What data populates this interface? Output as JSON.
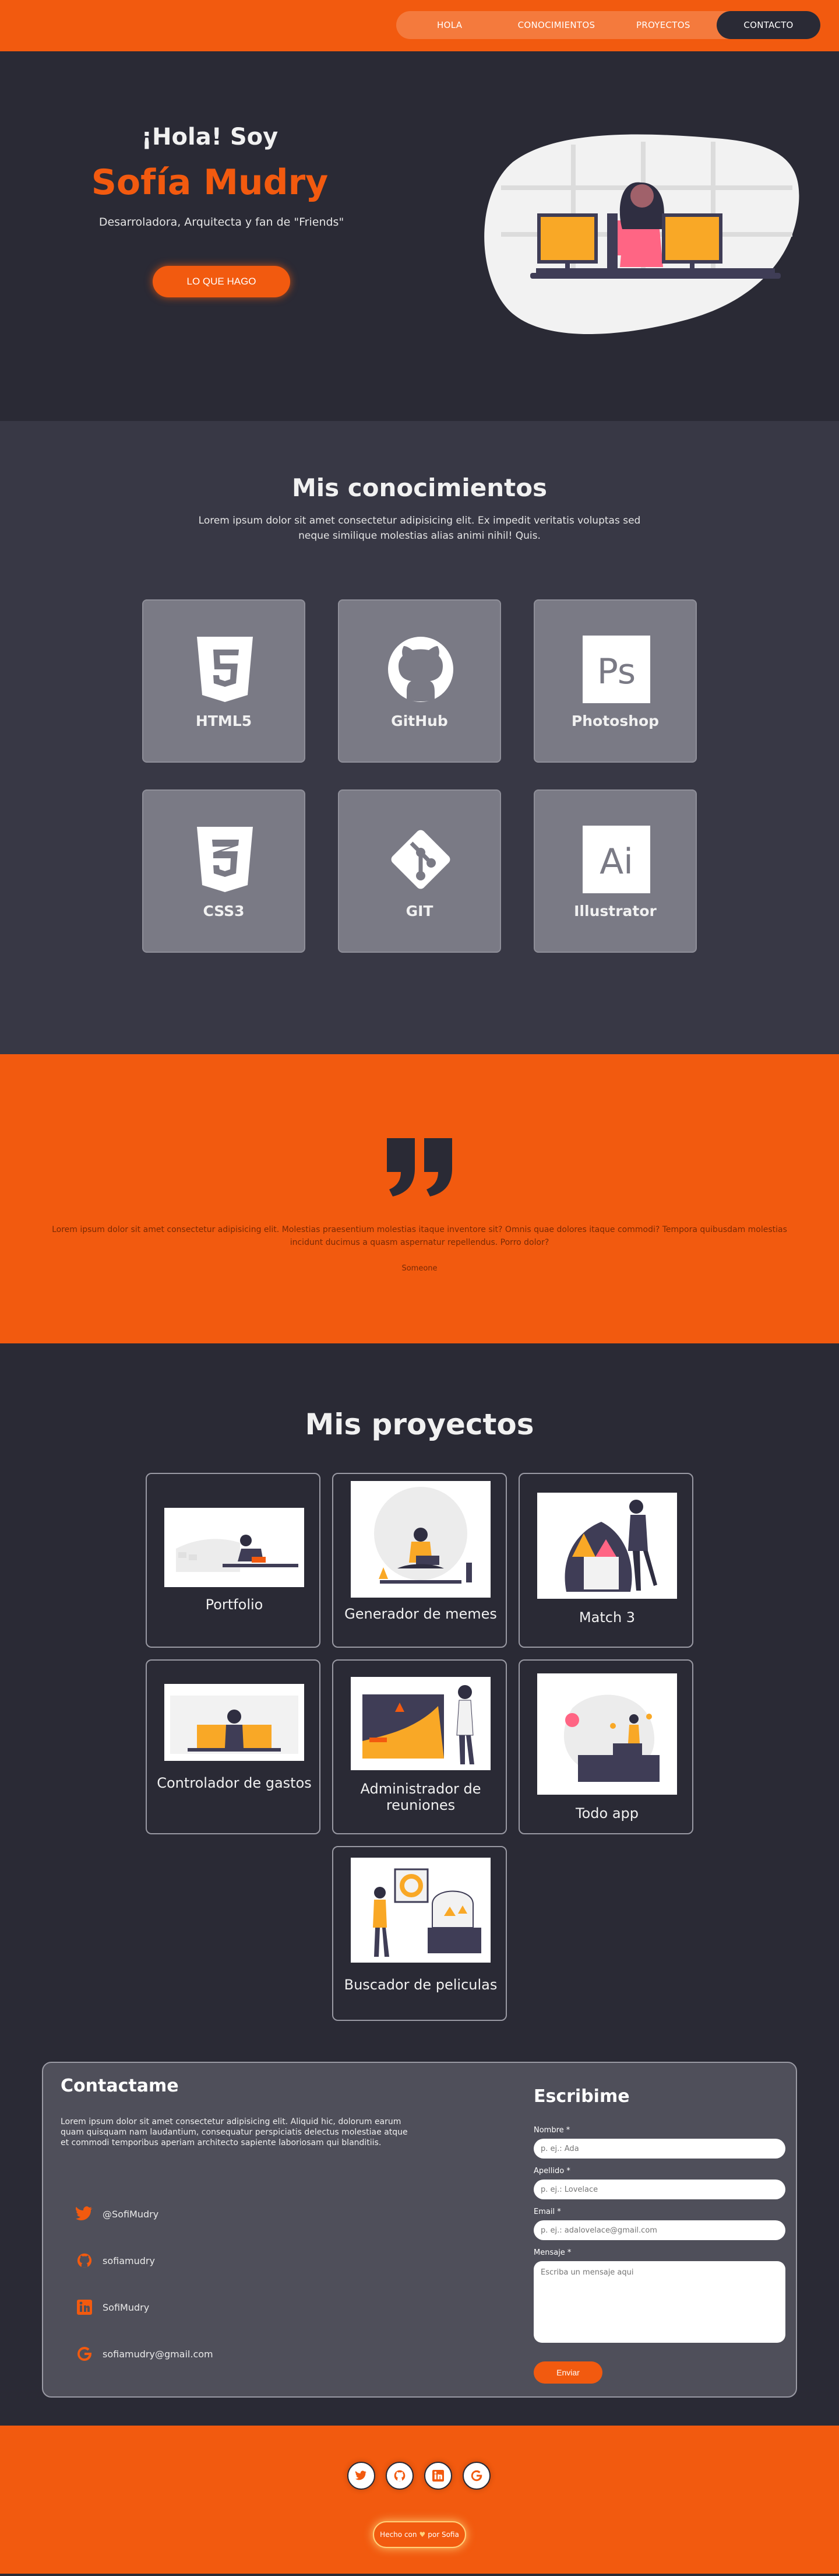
{
  "nav": {
    "items": [
      "HOLA",
      "CONOCIMIENTOS",
      "PROYECTOS",
      "CONTACTO"
    ]
  },
  "hero": {
    "greeting": "¡Hola! Soy",
    "name": "Sofía Mudry",
    "subtitle": "Desarroladora, Arquitecta y fan de \"Friends\"",
    "button": "LO QUE HAGO"
  },
  "knowledge": {
    "title": "Mis conocimientos",
    "description": "Lorem ipsum dolor sit amet consectetur adipisicing elit. Ex impedit veritatis voluptas sed neque similique molestias alias animi nihil! Quis.",
    "skills": [
      {
        "label": "HTML5",
        "icon": "html5-icon"
      },
      {
        "label": "GitHub",
        "icon": "github-icon"
      },
      {
        "label": "Photoshop",
        "icon": "photoshop-icon"
      },
      {
        "label": "CSS3",
        "icon": "css3-icon"
      },
      {
        "label": "GIT",
        "icon": "git-icon"
      },
      {
        "label": "Illustrator",
        "icon": "illustrator-icon"
      }
    ]
  },
  "quote": {
    "text": "Lorem ipsum dolor sit amet consectetur adipisicing elit. Molestias praesentium molestias itaque inventore sit? Omnis quae dolores itaque commodi? Tempora quibusdam molestias incidunt ducimus a quasm aspernatur repellendus. Porro dolor?",
    "author": "Someone"
  },
  "projects": {
    "title": "Mis proyectos",
    "items": [
      {
        "label": "Portfolio"
      },
      {
        "label": "Generador de memes"
      },
      {
        "label": "Match 3"
      },
      {
        "label": "Controlador de gastos"
      },
      {
        "label": "Administrador de reuniones"
      },
      {
        "label": "Todo app"
      },
      {
        "label": "Buscador de peliculas"
      }
    ]
  },
  "contact": {
    "title": "Contactame",
    "description": "Lorem ipsum dolor sit amet consectetur adipisicing elit. Aliquid hic, dolorum earum quam quisquam nam laudantium, consequatur perspiciatis delectus molestiae atque et commodi temporibus aperiam architecto sapiente laboriosam qui blanditiis.",
    "socials": [
      {
        "label": "@SofiMudry",
        "icon": "twitter-icon"
      },
      {
        "label": "sofiamudry",
        "icon": "github-icon"
      },
      {
        "label": "SofiMudry",
        "icon": "linkedin-icon"
      },
      {
        "label": "sofiamudry@gmail.com",
        "icon": "google-icon"
      }
    ],
    "form": {
      "title": "Escribime",
      "name_label": "Nombre *",
      "name_placeholder": "p. ej.: Ada",
      "lastname_label": "Apellido *",
      "lastname_placeholder": "p. ej.: Lovelace",
      "email_label": "Email *",
      "email_placeholder": "p. ej.: adalovelace@gmail.com",
      "message_label": "Mensaje *",
      "message_placeholder": "Escriba un mensaje aqui",
      "submit": "Enviar"
    }
  },
  "footer": {
    "icons": [
      "twitter-icon",
      "github-icon",
      "linkedin-icon",
      "google-icon"
    ],
    "made_prefix": "Hecho con",
    "made_heart": "♥",
    "made_suffix": "por Sofia"
  },
  "colors": {
    "accent": "#f25a0f",
    "dark": "#2a2a35",
    "card": "#7a7a85"
  }
}
